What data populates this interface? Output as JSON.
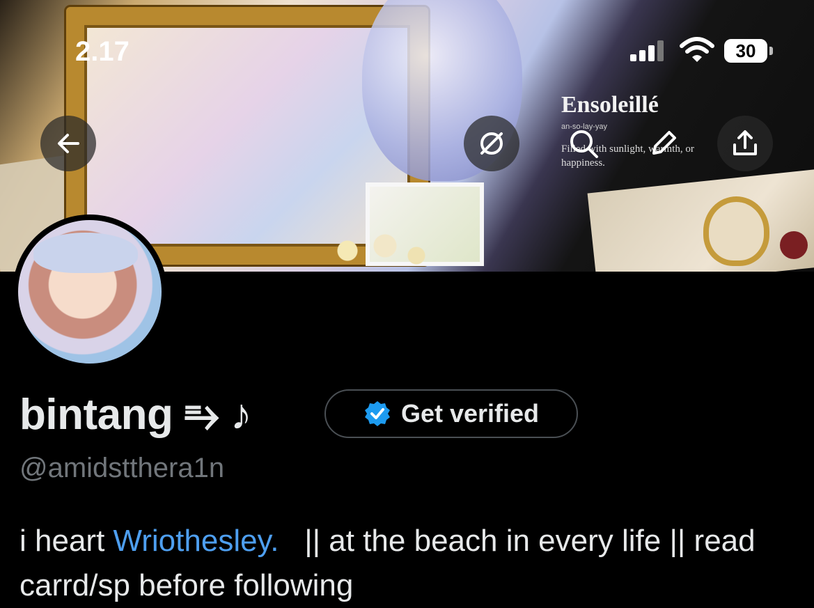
{
  "status_bar": {
    "time": "2.17",
    "battery": "30"
  },
  "banner": {
    "title": "Ensoleillé",
    "phonetic": "an-so-lay-yay",
    "definition": "Filled with sunlight, warmth, or happiness."
  },
  "nav": {
    "back_icon": "arrow-left-icon",
    "grok_icon": "grok-icon",
    "search_icon": "search-icon",
    "edit_icon": "pencil-icon",
    "share_icon": "share-icon"
  },
  "profile": {
    "display_name": "bintang ⥱ ♪",
    "verify_label": "Get verified",
    "handle": "@amidstthera1n",
    "bio_prefix": "i heart ",
    "bio_mention": "Wriothesley.",
    "bio_suffix": "   || at the beach in every life || read carrd/sp before following"
  },
  "colors": {
    "background": "#000000",
    "text": "#e7e9ea",
    "secondary": "#71767b",
    "accent": "#4e9ff0",
    "verified_badge": "#1d9bf0"
  }
}
